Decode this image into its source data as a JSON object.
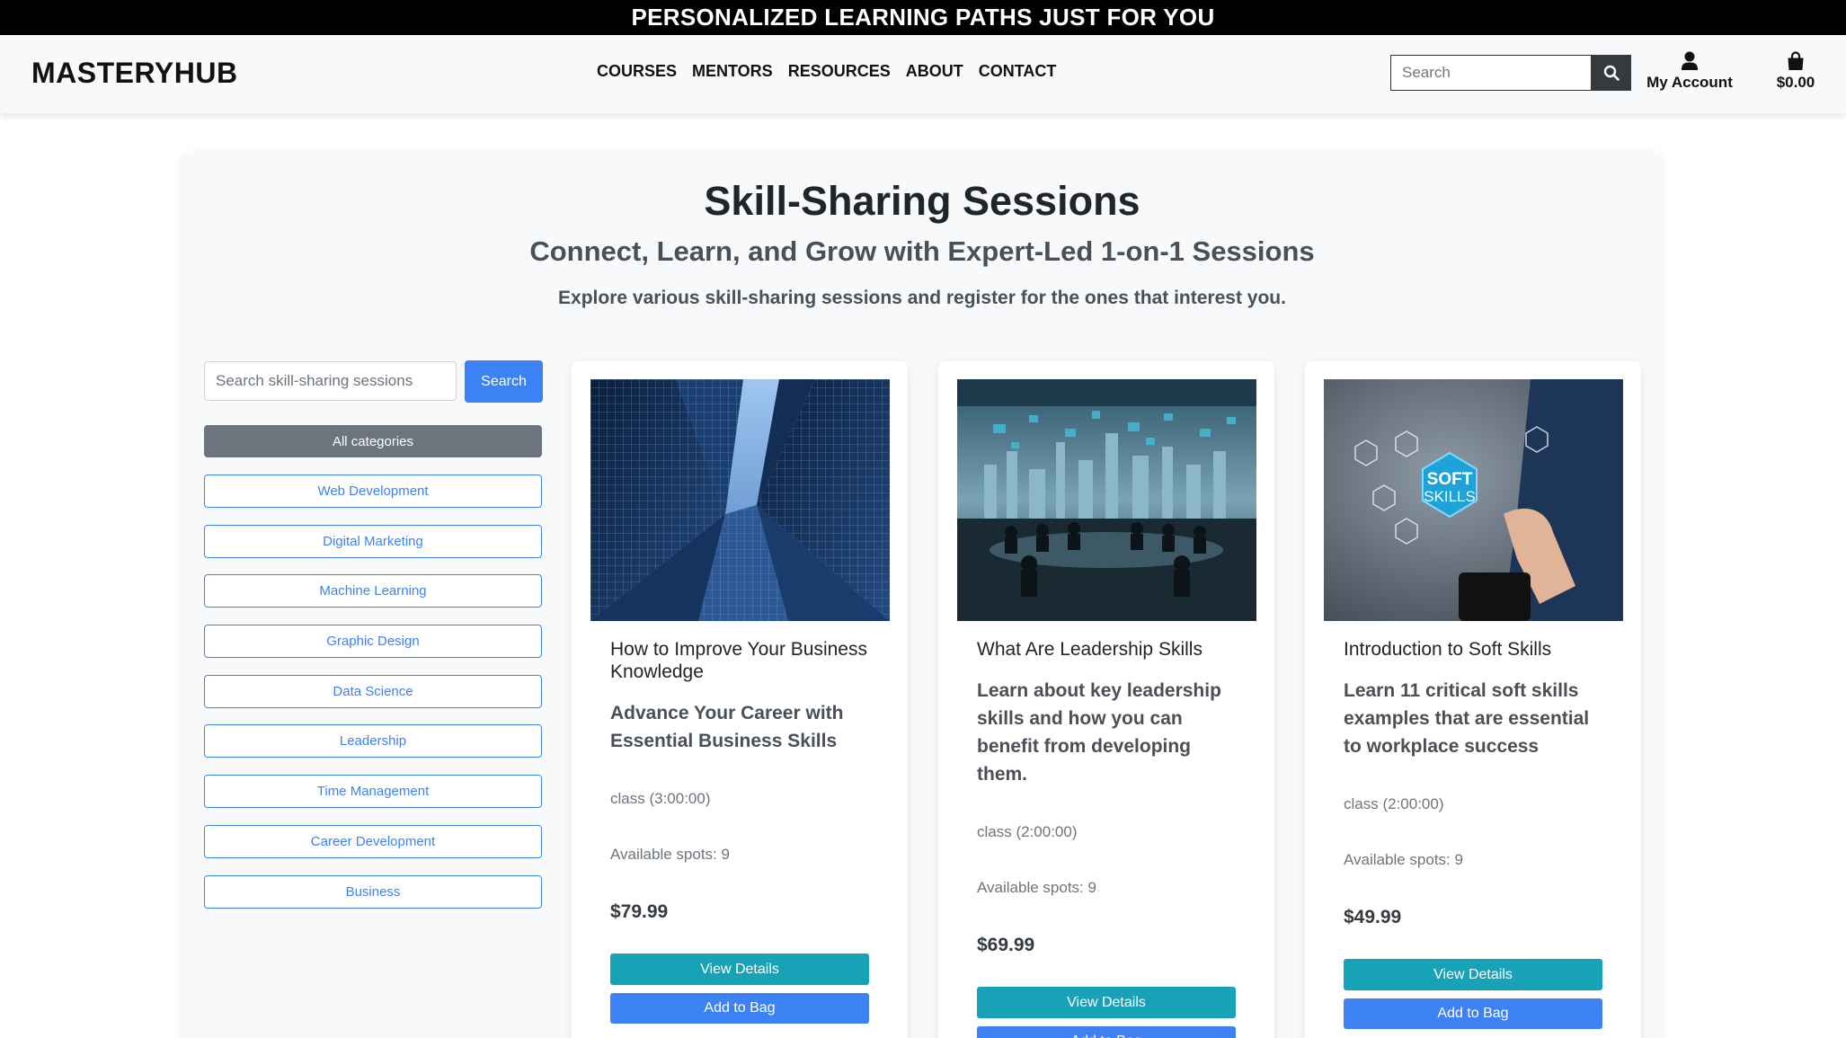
{
  "banner": {
    "text": "PERSONALIZED LEARNING PATHS JUST FOR YOU"
  },
  "navbar": {
    "brand": "MASTERYHUB",
    "links": [
      "COURSES",
      "MENTORS",
      "RESOURCES",
      "ABOUT",
      "CONTACT"
    ],
    "search_placeholder": "Search",
    "account_label": "My Account",
    "bag_total": "$0.00"
  },
  "page": {
    "title": "Skill-Sharing Sessions",
    "subtitle": "Connect, Learn, and Grow with Expert-Led 1-on-1 Sessions",
    "intro": "Explore various skill-sharing sessions and register for the ones that interest you."
  },
  "sidebar": {
    "search_placeholder": "Search skill-sharing sessions",
    "search_button": "Search",
    "categories": [
      "All categories",
      "Web Development",
      "Digital Marketing",
      "Machine Learning",
      "Graphic Design",
      "Data Science",
      "Leadership",
      "Time Management",
      "Career Development",
      "Business"
    ]
  },
  "cards": [
    {
      "title": "How to Improve Your Business Knowledge",
      "description": "Advance Your Career with Essential Business Skills",
      "duration": "class (3:00:00)",
      "spots": "Available spots: 9",
      "price": "$79.99",
      "details_label": "View Details",
      "bag_label": "Add to Bag"
    },
    {
      "title": "What Are Leadership Skills",
      "description": "Learn about key leadership skills and how you can benefit from developing them.",
      "duration": "class (2:00:00)",
      "spots": "Available spots: 9",
      "price": "$69.99",
      "details_label": "View Details",
      "bag_label": "Add to Bag"
    },
    {
      "title": "Introduction to Soft Skills",
      "description": "Learn 11 critical soft skills examples that are essential to workplace success",
      "duration": "class (2:00:00)",
      "spots": "Available spots: 9",
      "price": "$49.99",
      "details_label": "View Details",
      "bag_label": "Add to Bag",
      "image_text_1": "SOFT",
      "image_text_2": "SKILLS"
    }
  ],
  "colors": {
    "primary": "#3d82f5",
    "info": "#17a2b8",
    "dark": "#343a40",
    "secondary": "#6c757d"
  },
  "icons": {
    "search": "search-icon",
    "account": "user-icon",
    "bag": "shopping-bag-icon"
  }
}
